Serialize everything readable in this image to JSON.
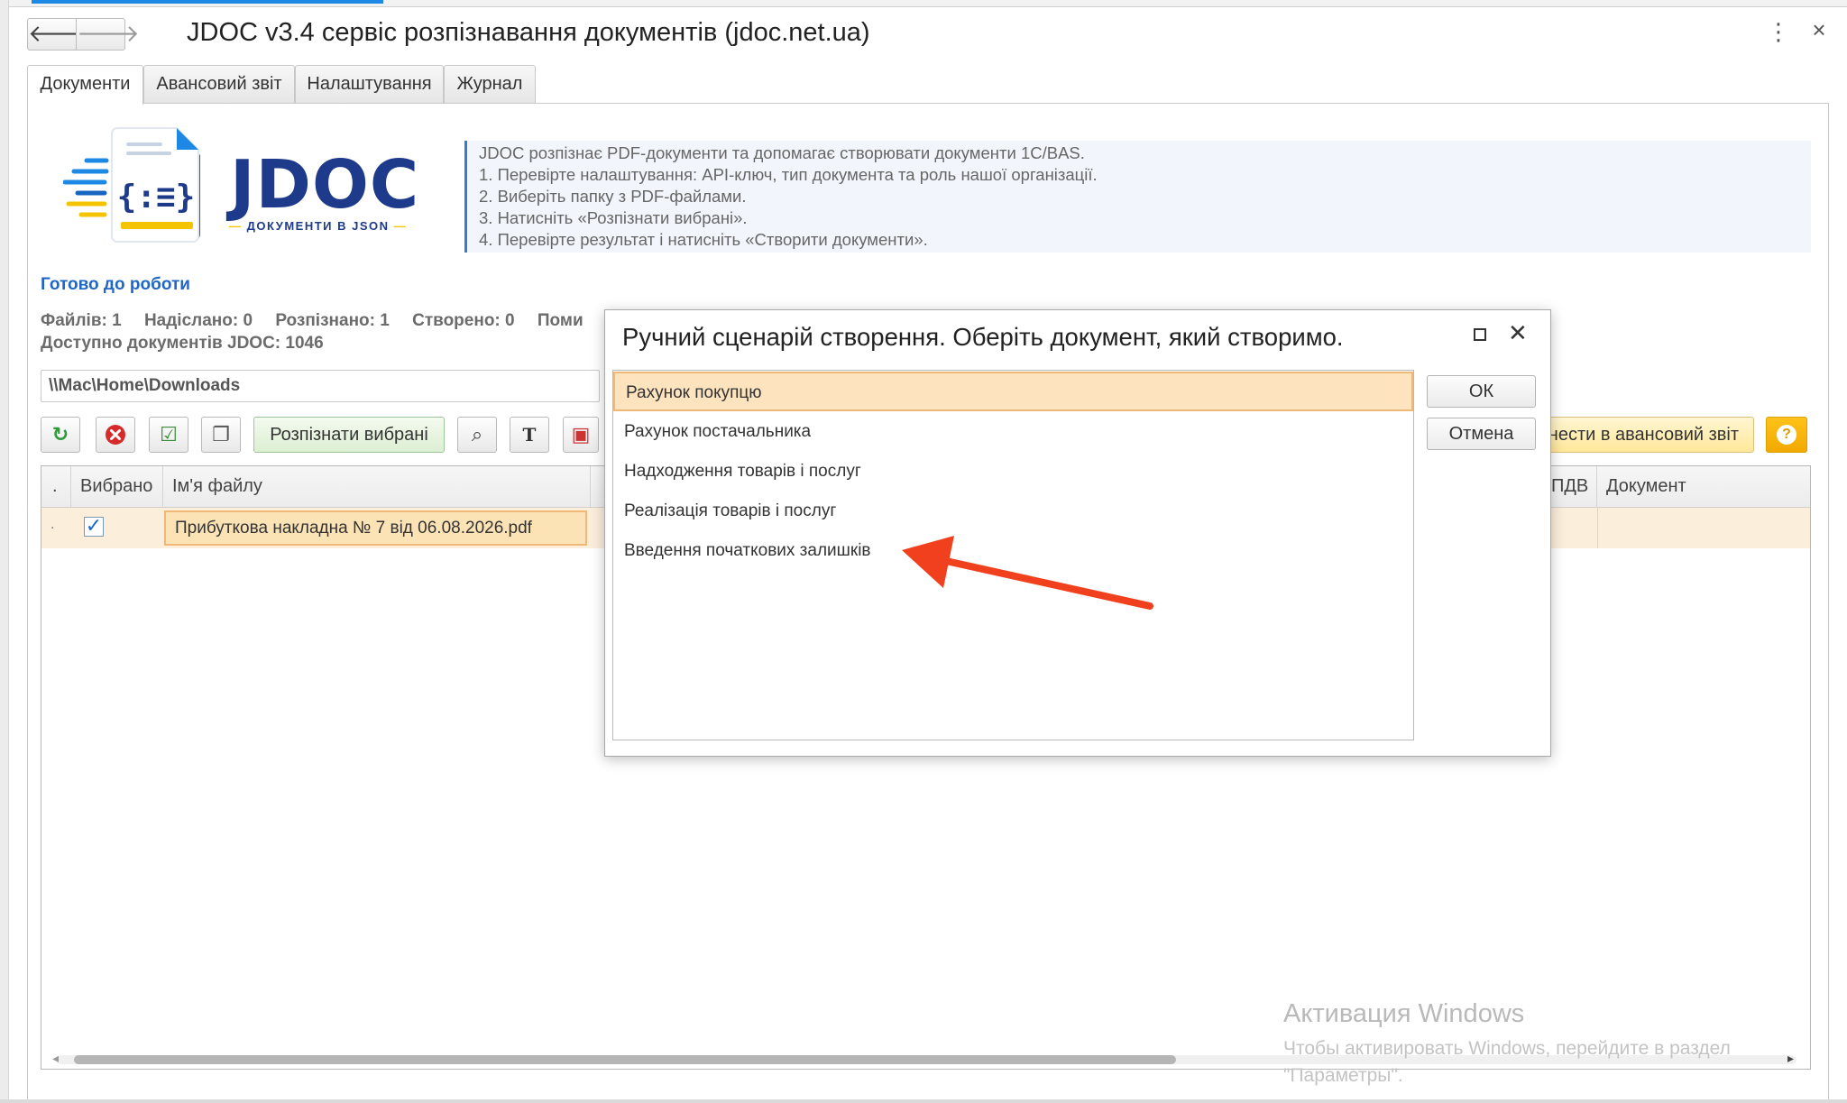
{
  "window": {
    "title": "JDOC v3.4 сервіс розпізнавання документів (jdoc.net.ua)",
    "back_glyph": "🡐",
    "forward_glyph": "🡒",
    "more_glyph": "⋮",
    "close_glyph": "×"
  },
  "tabs": [
    {
      "label": "Документи",
      "active": true
    },
    {
      "label": "Авансовий звіт",
      "active": false
    },
    {
      "label": "Налаштування",
      "active": false
    },
    {
      "label": "Журнал",
      "active": false
    }
  ],
  "logo": {
    "text": "JDOC",
    "tagline": "ДОКУМЕНТИ В JSON",
    "tagline_dash": "—",
    "brackets": "{:≡}"
  },
  "info": {
    "lines": [
      "JDOC розпізнає PDF-документи та допомагає створювати документи 1С/BAS.",
      "1. Перевірте налаштування: API-ключ, тип документа та роль нашої організації.",
      "2. Виберіть папку з PDF-файлами.",
      "3. Натисніть «Розпізнати вибрані».",
      "4. Перевірте результат і натисніть «Створити документи»."
    ]
  },
  "status": {
    "title": "Готово до роботи",
    "files": "Файлів: 1",
    "sent": "Надіслано: 0",
    "recognized": "Розпізнано: 1",
    "created": "Створено: 0",
    "errors_truncated": "Поми",
    "available": "Доступно документів JDOC: 1046"
  },
  "path": {
    "value": "\\\\Mac\\Home\\Downloads"
  },
  "toolbar": {
    "refresh_glyph": "↻",
    "stop_glyph": "✖",
    "check_all_glyph": "☑",
    "copy_glyph": "❐",
    "recognize_label": "Розпізнати вибрані",
    "zoom_glyph": "⌕",
    "text_glyph": "T",
    "image_glyph": "▣",
    "advance_label": "нести в авансовий звіт",
    "help_glyph": "?"
  },
  "grid": {
    "headers": {
      "dot": ".",
      "selected": "Вибрано",
      "filename": "Ім'я файлу",
      "vat": "ПДВ",
      "document": "Документ"
    },
    "rows": [
      {
        "dot": ".",
        "checked": "✓",
        "filename": "Прибуткова накладна № 7 від 06.08.2026.pdf"
      }
    ],
    "scroll_left": "◂",
    "scroll_right": "▸"
  },
  "dialog": {
    "title": "Ручний сценарій створення. Оберіть документ, який створимо.",
    "close_glyph": "✕",
    "items": [
      "Рахунок покупцю",
      "Рахунок постачальника",
      "Надходження товарів і послуг",
      "Реалізація товарів і послуг",
      "Введення початкових залишків"
    ],
    "ok_label": "ОК",
    "cancel_label": "Отмена"
  },
  "watermark": {
    "title": "Активация Windows",
    "subtitle": "Чтобы активировать Windows, перейдите в раздел \"Параметры\"."
  },
  "colors": {
    "accent_blue": "#1f66c7",
    "selection_orange": "#f0b877",
    "arrow_red": "#f0401e"
  }
}
